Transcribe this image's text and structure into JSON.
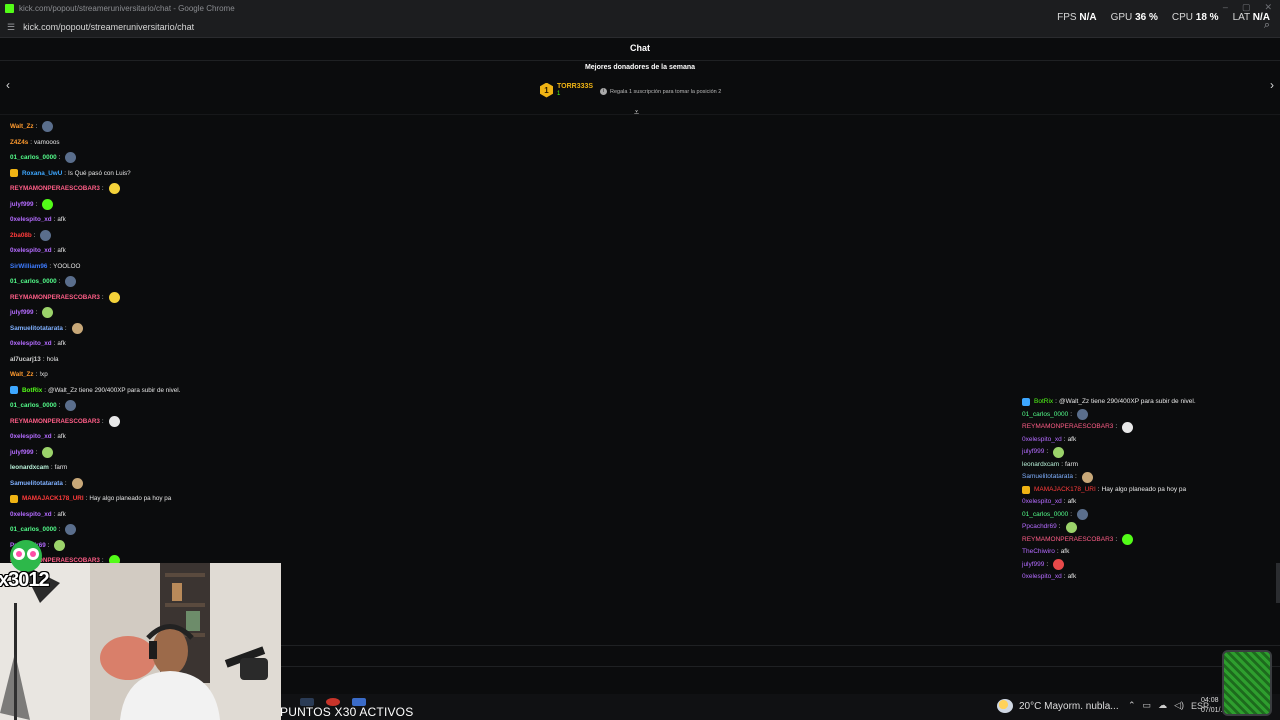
{
  "browser": {
    "window_title": "kick.com/popout/streameruniversitario/chat - Google Chrome",
    "url": "kick.com/popout/streameruniversitario/chat"
  },
  "perf": {
    "fps_label": "FPS",
    "fps_value": "N/A",
    "gpu_label": "GPU",
    "gpu_value": "36 %",
    "cpu_label": "CPU",
    "cpu_value": "18 %",
    "lat_label": "LAT",
    "lat_value": "N/A"
  },
  "chat_header": {
    "title": "Chat",
    "donors_title": "Mejores donadores de la semana",
    "top_donor_rank": "1",
    "top_donor_name": "TORR333S",
    "top_donor_sub": "1",
    "give_text": "Regala 1 suscripción para tomar la posición 2"
  },
  "messages": [
    {
      "user": "Walt_Zz",
      "color": "#ff9a2e",
      "text": "",
      "emote": "#5a6e8c"
    },
    {
      "user": "Z4Z4s",
      "color": "#ff9a2e",
      "text": "vamooos",
      "emote": ""
    },
    {
      "user": "01_carlos_0000",
      "color": "#53fc8a",
      "text": "",
      "emote": "#5a6e8c"
    },
    {
      "user": "Roxana_UwU",
      "color": "#3da7ff",
      "text": "Is Qué pasó con Luis?",
      "emote": "",
      "badge": "#f0b414"
    },
    {
      "user": "REYMAMONPERAESCOBAR3",
      "color": "#ff5e87",
      "text": "",
      "emote": "#f5d33a"
    },
    {
      "user": "julyf999",
      "color": "#b46bff",
      "text": "",
      "emote": "#53fc18"
    },
    {
      "user": "0xelespito_xd",
      "color": "#b46bff",
      "text": "afk",
      "emote": ""
    },
    {
      "user": "2ba08b",
      "color": "#ff3b3b",
      "text": "",
      "emote": "#5a6e8c"
    },
    {
      "user": "0xelespito_xd",
      "color": "#b46bff",
      "text": "afk",
      "emote": ""
    },
    {
      "user": "SirWilliam96",
      "color": "#3d7bff",
      "text": "YOOLOO",
      "emote": ""
    },
    {
      "user": "01_carlos_0000",
      "color": "#53fc8a",
      "text": "",
      "emote": "#5a6e8c"
    },
    {
      "user": "REYMAMONPERAESCOBAR3",
      "color": "#ff5e87",
      "text": "",
      "emote": "#f5d33a"
    },
    {
      "user": "julyf999",
      "color": "#b46bff",
      "text": "",
      "emote": "#9bd36a"
    },
    {
      "user": "Samuelitotatarata",
      "color": "#7fb0ff",
      "text": "",
      "emote": "#c8a878"
    },
    {
      "user": "0xelespito_xd",
      "color": "#b46bff",
      "text": "afk",
      "emote": ""
    },
    {
      "user": "al7ucarj13",
      "color": "#d0d0d0",
      "text": "hola",
      "emote": ""
    },
    {
      "user": "Walt_Zz",
      "color": "#ff9a2e",
      "text": "!xp",
      "emote": ""
    },
    {
      "user": "BotRix",
      "color": "#53fc18",
      "text": "@Walt_Zz tiene 290/400XP para subir de nivel.",
      "emote": "",
      "badge": "#3da7ff"
    },
    {
      "user": "01_carlos_0000",
      "color": "#53fc8a",
      "text": "",
      "emote": "#5a6e8c"
    },
    {
      "user": "REYMAMONPERAESCOBAR3",
      "color": "#ff5e87",
      "text": "",
      "emote": "#e8e8e8"
    },
    {
      "user": "0xelespito_xd",
      "color": "#b46bff",
      "text": "afk",
      "emote": ""
    },
    {
      "user": "julyf999",
      "color": "#b46bff",
      "text": "",
      "emote": "#9bd36a"
    },
    {
      "user": "leonardxcam",
      "color": "#b8f0d8",
      "text": "farm",
      "emote": ""
    },
    {
      "user": "Samuelitotatarata",
      "color": "#7fb0ff",
      "text": "",
      "emote": "#c8a878"
    },
    {
      "user": "MAMAJACK178_URI",
      "color": "#ff3b3b",
      "text": "Hay algo planeado pa hoy pa",
      "emote": "",
      "badge": "#f0b414"
    },
    {
      "user": "0xelespito_xd",
      "color": "#b46bff",
      "text": "afk",
      "emote": ""
    },
    {
      "user": "01_carlos_0000",
      "color": "#53fc8a",
      "text": "",
      "emote": "#5a6e8c"
    },
    {
      "user": "Ppcachdr69",
      "color": "#b46bff",
      "text": "",
      "emote": "#9bd36a"
    },
    {
      "user": "REYMAMONPERAESCOBAR3",
      "color": "#ff5e87",
      "text": "",
      "emote": "#53fc18"
    }
  ],
  "mini_chat": [
    {
      "user": "BotRix",
      "color": "#53fc18",
      "text": "@Walt_Zz tiene 290/400XP para subir de nivel.",
      "badge": "#3da7ff"
    },
    {
      "user": "01_carlos_0000",
      "color": "#53fc8a",
      "text": "",
      "emote": "#5a6e8c"
    },
    {
      "user": "REYMAMONPERAESCOBAR3",
      "color": "#ff5e87",
      "text": "",
      "emote": "#e8e8e8"
    },
    {
      "user": "0xelespito_xd",
      "color": "#b46bff",
      "text": "afk"
    },
    {
      "user": "julyf999",
      "color": "#b46bff",
      "text": "",
      "emote": "#9bd36a"
    },
    {
      "user": "leonardxcam",
      "color": "#b8f0d8",
      "text": "farm"
    },
    {
      "user": "Samuelitotatarata",
      "color": "#7fb0ff",
      "text": "",
      "emote": "#c8a878"
    },
    {
      "user": "MAMAJACK178_URI",
      "color": "#ff3b3b",
      "text": "Hay algo planeado pa hoy pa",
      "badge": "#f0b414"
    },
    {
      "user": "0xelespito_xd",
      "color": "#b46bff",
      "text": "afk"
    },
    {
      "user": "01_carlos_0000",
      "color": "#53fc8a",
      "text": "",
      "emote": "#5a6e8c"
    },
    {
      "user": "Ppcachdr69",
      "color": "#b46bff",
      "text": "",
      "emote": "#9bd36a"
    },
    {
      "user": "REYMAMONPERAESCOBAR3",
      "color": "#ff5e87",
      "text": "",
      "emote": "#53fc18"
    },
    {
      "user": "TheChiwiro",
      "color": "#b46bff",
      "text": "afk"
    },
    {
      "user": "julyf999",
      "color": "#b46bff",
      "text": "",
      "emote": "#e84a4a"
    },
    {
      "user": "0xelespito_xd",
      "color": "#b46bff",
      "text": "afk"
    }
  ],
  "overlay": {
    "counter": "x3012",
    "puntos": "PUNTOS X30 ACTIVOS"
  },
  "taskbar": {
    "weather": "20°C  Mayorm. nubla...",
    "lang": "ESP",
    "time": "04:08",
    "date": "07/01/..."
  }
}
